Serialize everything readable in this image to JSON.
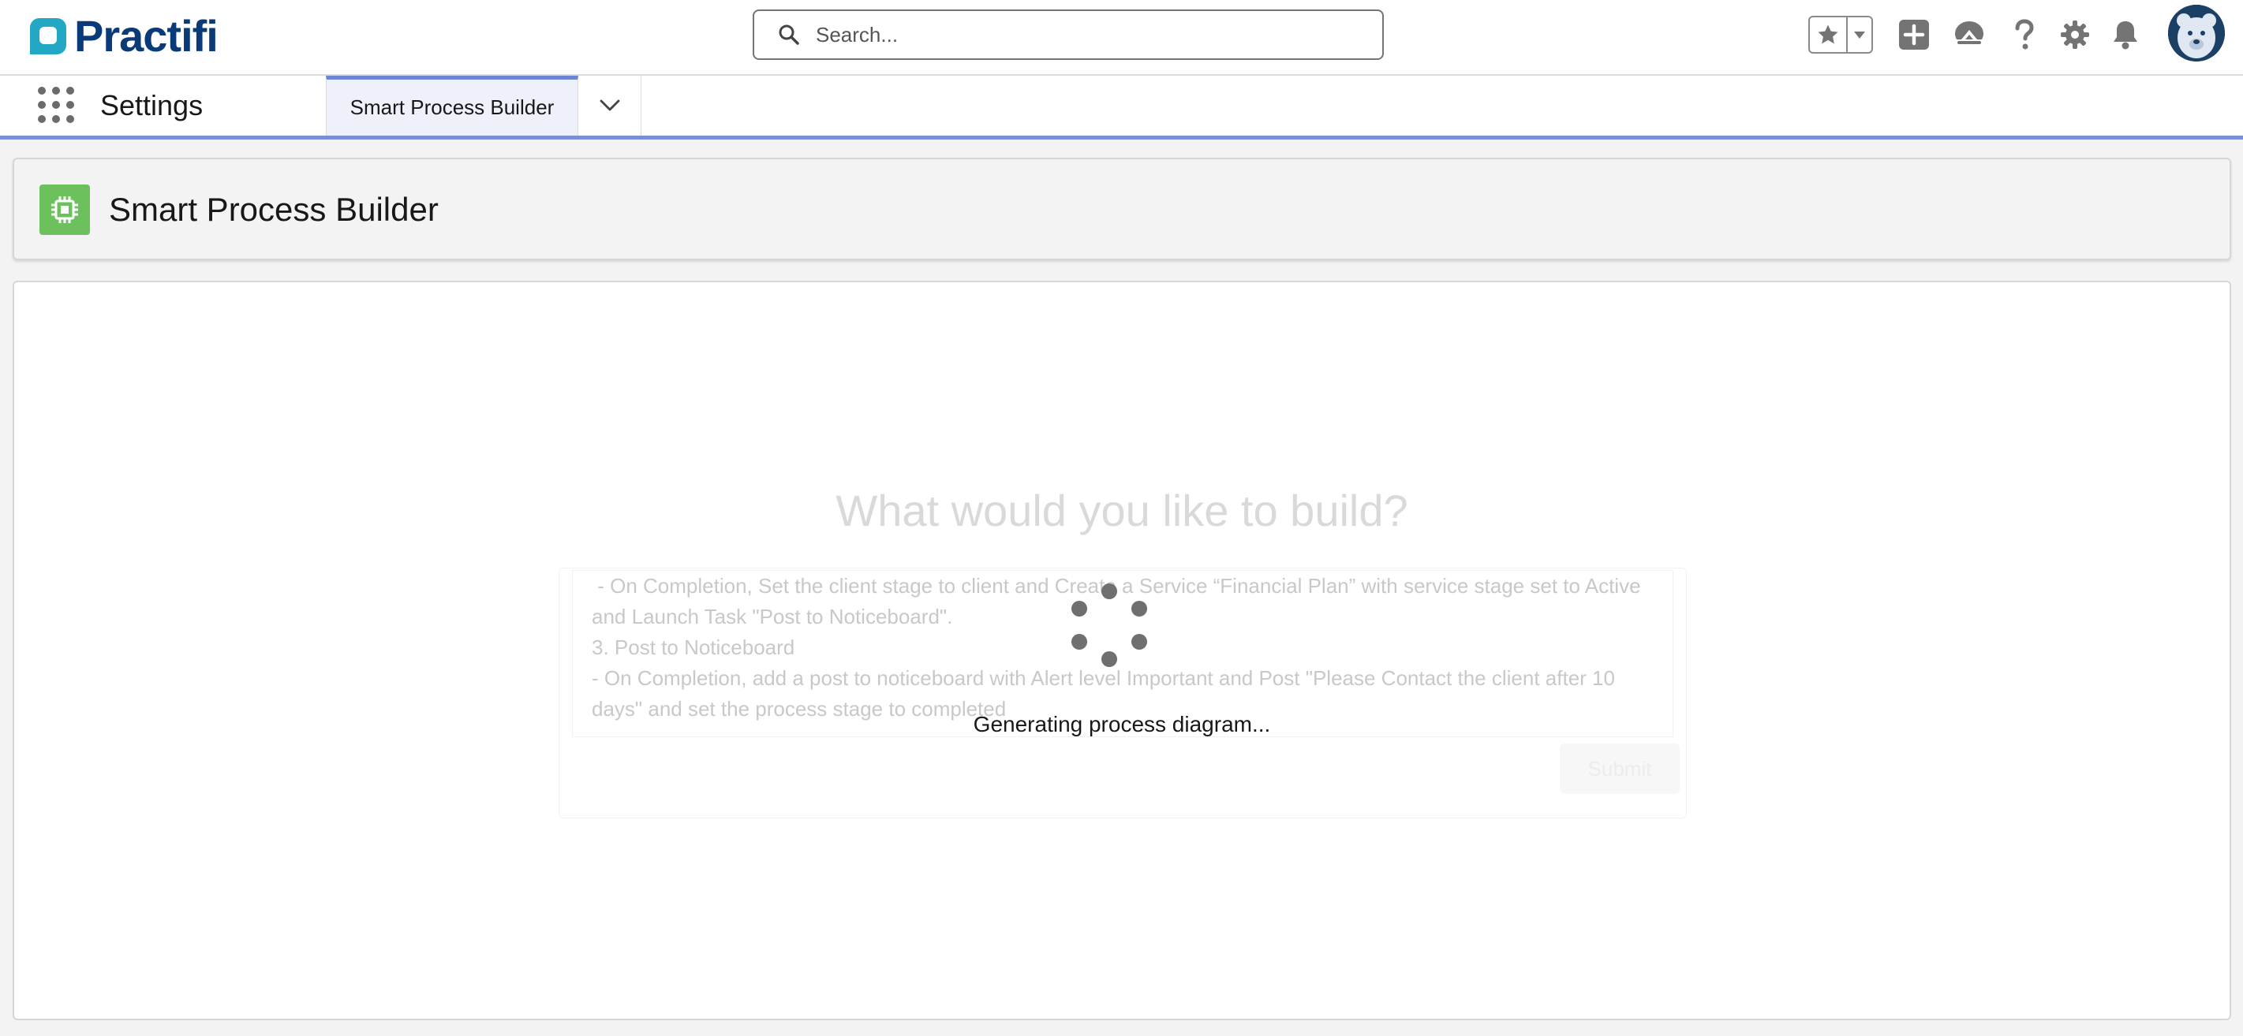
{
  "header": {
    "logo_text": "Practifi",
    "search_placeholder": "Search...",
    "icons": [
      "favorites-star-icon",
      "favorites-dropdown-icon",
      "global-actions-add-icon",
      "trailhead-icon",
      "help-icon",
      "setup-gear-icon",
      "notifications-bell-icon",
      "user-avatar"
    ]
  },
  "nav": {
    "app_name": "Settings",
    "tabs": [
      {
        "label": "Smart Process Builder",
        "active": true
      }
    ]
  },
  "page": {
    "title": "Smart Process Builder",
    "icon": "chip-icon",
    "icon_color": "#6cc15d"
  },
  "builder": {
    "heading": "What would you like to build?",
    "prompt_text": " - On Completion, Set the client stage to client and Create a Service “Financial Plan” with service stage set to Active and Launch Task \"Post to Noticeboard\".\n3. Post to Noticeboard\n- On Completion, add a post to noticeboard with Alert level Important and Post \"Please Contact the client after 10 days\" and set the process stage to completed",
    "submit_label": "Submit",
    "loading_text": "Generating process diagram..."
  },
  "colors": {
    "brand_navy": "#0b3a78",
    "brand_teal": "#22a7c4",
    "nav_accent": "#7b8fd6"
  }
}
